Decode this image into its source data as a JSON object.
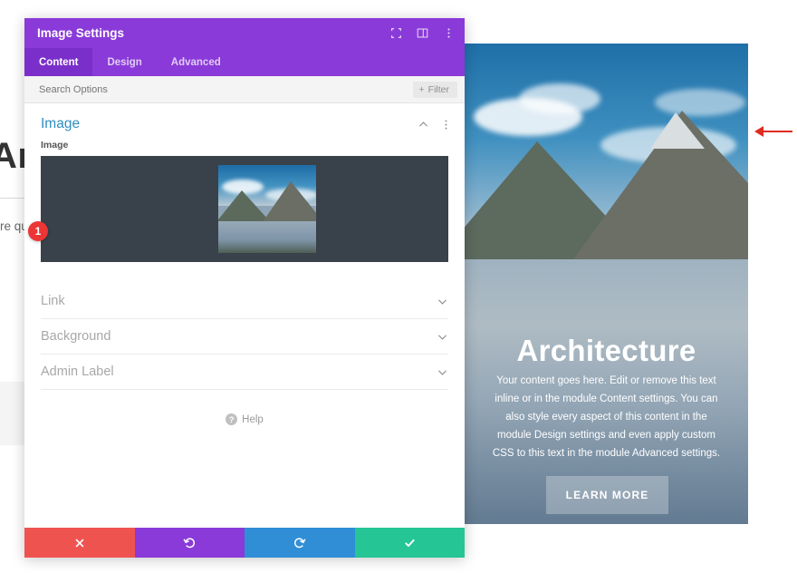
{
  "page": {
    "heading": "Arc",
    "paragraph": "ctetur ... labore  quis n  comm  rit in v  ur."
  },
  "preview": {
    "title": "Architecture",
    "body": "Your content goes here. Edit or remove this text inline or in the module Content settings. You can also style every aspect of this content in the module Design settings and even apply custom CSS to this text in the module Advanced settings.",
    "cta_label": "LEARN MORE"
  },
  "annotation": {
    "arrow": "left-pointing-red-arrow",
    "arrow_color": "#e02b20"
  },
  "modal": {
    "title": "Image Settings",
    "header_icons": [
      "expand-icon",
      "layout-icon",
      "more-options-icon"
    ],
    "tabs": [
      {
        "label": "Content",
        "active": true
      },
      {
        "label": "Design",
        "active": false
      },
      {
        "label": "Advanced",
        "active": false
      }
    ],
    "search": {
      "placeholder": "Search Options",
      "filter_label": "Filter",
      "filter_icon": "plus-icon"
    },
    "section": {
      "title": "Image",
      "collapse_icon": "chevron-up-icon",
      "more_icon": "more-options-icon",
      "field_label": "Image",
      "badge": "1"
    },
    "accordions": [
      {
        "label": "Link",
        "icon": "chevron-down-icon"
      },
      {
        "label": "Background",
        "icon": "chevron-down-icon"
      },
      {
        "label": "Admin Label",
        "icon": "chevron-down-icon"
      }
    ],
    "help": {
      "label": "Help",
      "icon": "question-mark-icon"
    },
    "footer": [
      {
        "name": "cancel",
        "icon": "x-icon",
        "color": "#ef5350"
      },
      {
        "name": "undo",
        "icon": "undo-icon",
        "color": "#8a3ad8"
      },
      {
        "name": "redo",
        "icon": "redo-icon",
        "color": "#2f8ed6"
      },
      {
        "name": "save",
        "icon": "check-icon",
        "color": "#25c595"
      }
    ]
  }
}
